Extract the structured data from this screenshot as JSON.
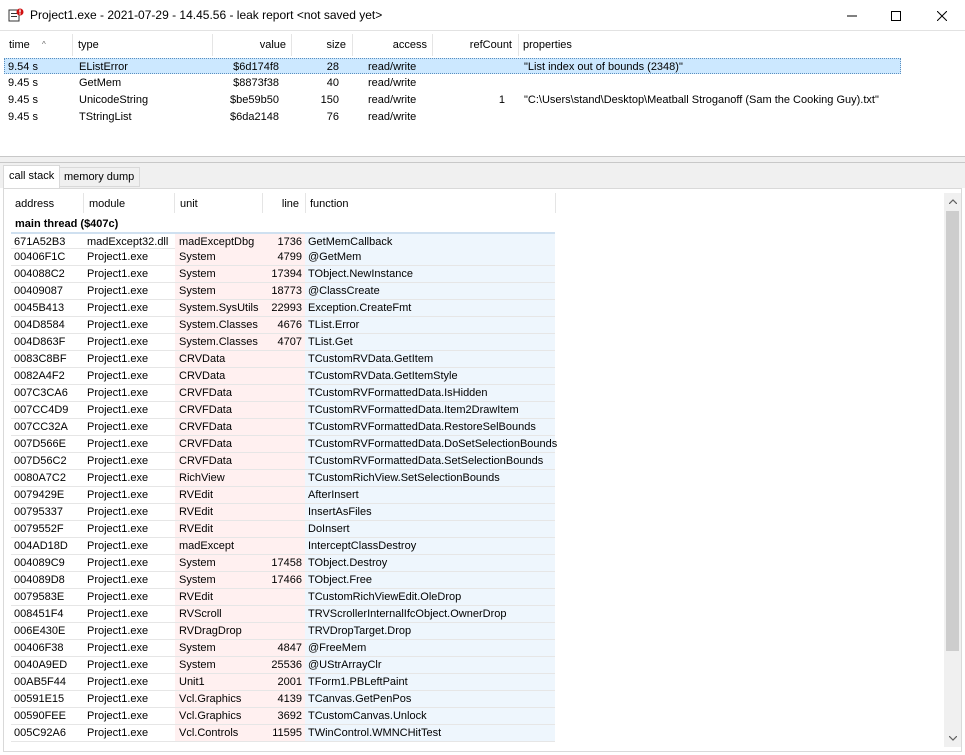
{
  "window": {
    "title": "Project1.exe - 2021-07-29 - 14.45.56 - leak report  <not saved yet>",
    "icons": {
      "app": "app-icon",
      "minimize": "minimize-icon",
      "maximize": "maximize-icon",
      "close": "close-icon"
    }
  },
  "leaks": {
    "columns": {
      "time": "time",
      "type": "type",
      "value": "value",
      "size": "size",
      "access": "access",
      "refcount": "refCount",
      "properties": "properties"
    },
    "rows": [
      {
        "time": "9.54 s",
        "type": "EListError",
        "value": "$6d174f8",
        "size": "28",
        "access": "read/write",
        "refcount": "",
        "properties": "\"List index out of bounds (2348)\""
      },
      {
        "time": "9.45 s",
        "type": "GetMem",
        "value": "$8873f38",
        "size": "40",
        "access": "read/write",
        "refcount": "",
        "properties": ""
      },
      {
        "time": "9.45 s",
        "type": "UnicodeString",
        "value": "$be59b50",
        "size": "150",
        "access": "read/write",
        "refcount": "1",
        "properties": "\"C:\\Users\\stand\\Desktop\\Meatball Stroganoff (Sam the Cooking Guy).txt\""
      },
      {
        "time": "9.45 s",
        "type": "TStringList",
        "value": "$6da2148",
        "size": "76",
        "access": "read/write",
        "refcount": "",
        "properties": ""
      }
    ]
  },
  "tabs": [
    {
      "label": "call stack"
    },
    {
      "label": "memory dump"
    }
  ],
  "callstack": {
    "columns": {
      "address": "address",
      "module": "module",
      "unit": "unit",
      "line": "line",
      "function": "function"
    },
    "thread": "main thread ($407c)",
    "rows": [
      {
        "address": "671A52B3",
        "module": "madExcept32.dll",
        "unit": "madExceptDbg",
        "line": "1736",
        "function": "GetMemCallback"
      },
      {
        "address": "00406F1C",
        "module": "Project1.exe",
        "unit": "System",
        "line": "4799",
        "function": "@GetMem"
      },
      {
        "address": "004088C2",
        "module": "Project1.exe",
        "unit": "System",
        "line": "17394",
        "function": "TObject.NewInstance"
      },
      {
        "address": "00409087",
        "module": "Project1.exe",
        "unit": "System",
        "line": "18773",
        "function": "@ClassCreate"
      },
      {
        "address": "0045B413",
        "module": "Project1.exe",
        "unit": "System.SysUtils",
        "line": "22993",
        "function": "Exception.CreateFmt"
      },
      {
        "address": "004D8584",
        "module": "Project1.exe",
        "unit": "System.Classes",
        "line": "4676",
        "function": "TList.Error"
      },
      {
        "address": "004D863F",
        "module": "Project1.exe",
        "unit": "System.Classes",
        "line": "4707",
        "function": "TList.Get"
      },
      {
        "address": "0083C8BF",
        "module": "Project1.exe",
        "unit": "CRVData",
        "line": "",
        "function": "TCustomRVData.GetItem"
      },
      {
        "address": "0082A4F2",
        "module": "Project1.exe",
        "unit": "CRVData",
        "line": "",
        "function": "TCustomRVData.GetItemStyle"
      },
      {
        "address": "007C3CA6",
        "module": "Project1.exe",
        "unit": "CRVFData",
        "line": "",
        "function": "TCustomRVFormattedData.IsHidden"
      },
      {
        "address": "007CC4D9",
        "module": "Project1.exe",
        "unit": "CRVFData",
        "line": "",
        "function": "TCustomRVFormattedData.Item2DrawItem"
      },
      {
        "address": "007CC32A",
        "module": "Project1.exe",
        "unit": "CRVFData",
        "line": "",
        "function": "TCustomRVFormattedData.RestoreSelBounds"
      },
      {
        "address": "007D566E",
        "module": "Project1.exe",
        "unit": "CRVFData",
        "line": "",
        "function": "TCustomRVFormattedData.DoSetSelectionBounds"
      },
      {
        "address": "007D56C2",
        "module": "Project1.exe",
        "unit": "CRVFData",
        "line": "",
        "function": "TCustomRVFormattedData.SetSelectionBounds"
      },
      {
        "address": "0080A7C2",
        "module": "Project1.exe",
        "unit": "RichView",
        "line": "",
        "function": "TCustomRichView.SetSelectionBounds"
      },
      {
        "address": "0079429E",
        "module": "Project1.exe",
        "unit": "RVEdit",
        "line": "",
        "function": "AfterInsert"
      },
      {
        "address": "00795337",
        "module": "Project1.exe",
        "unit": "RVEdit",
        "line": "",
        "function": "InsertAsFiles"
      },
      {
        "address": "0079552F",
        "module": "Project1.exe",
        "unit": "RVEdit",
        "line": "",
        "function": "DoInsert"
      },
      {
        "address": "004AD18D",
        "module": "Project1.exe",
        "unit": "madExcept",
        "line": "",
        "function": "InterceptClassDestroy"
      },
      {
        "address": "004089C9",
        "module": "Project1.exe",
        "unit": "System",
        "line": "17458",
        "function": "TObject.Destroy"
      },
      {
        "address": "004089D8",
        "module": "Project1.exe",
        "unit": "System",
        "line": "17466",
        "function": "TObject.Free"
      },
      {
        "address": "0079583E",
        "module": "Project1.exe",
        "unit": "RVEdit",
        "line": "",
        "function": "TCustomRichViewEdit.OleDrop"
      },
      {
        "address": "008451F4",
        "module": "Project1.exe",
        "unit": "RVScroll",
        "line": "",
        "function": "TRVScrollerInternalIfcObject.OwnerDrop"
      },
      {
        "address": "006E430E",
        "module": "Project1.exe",
        "unit": "RVDragDrop",
        "line": "",
        "function": "TRVDropTarget.Drop"
      },
      {
        "address": "00406F38",
        "module": "Project1.exe",
        "unit": "System",
        "line": "4847",
        "function": "@FreeMem"
      },
      {
        "address": "0040A9ED",
        "module": "Project1.exe",
        "unit": "System",
        "line": "25536",
        "function": "@UStrArrayClr"
      },
      {
        "address": "00AB5F44",
        "module": "Project1.exe",
        "unit": "Unit1",
        "line": "2001",
        "function": "TForm1.PBLeftPaint"
      },
      {
        "address": "00591E15",
        "module": "Project1.exe",
        "unit": "Vcl.Graphics",
        "line": "4139",
        "function": "TCanvas.GetPenPos"
      },
      {
        "address": "00590FEE",
        "module": "Project1.exe",
        "unit": "Vcl.Graphics",
        "line": "3692",
        "function": "TCustomCanvas.Unlock"
      },
      {
        "address": "005C92A6",
        "module": "Project1.exe",
        "unit": "Vcl.Controls",
        "line": "11595",
        "function": "TWinControl.WMNCHitTest"
      }
    ]
  },
  "scrollbar": {
    "up_icon": "arrow-up-icon",
    "down_icon": "arrow-down-icon"
  }
}
